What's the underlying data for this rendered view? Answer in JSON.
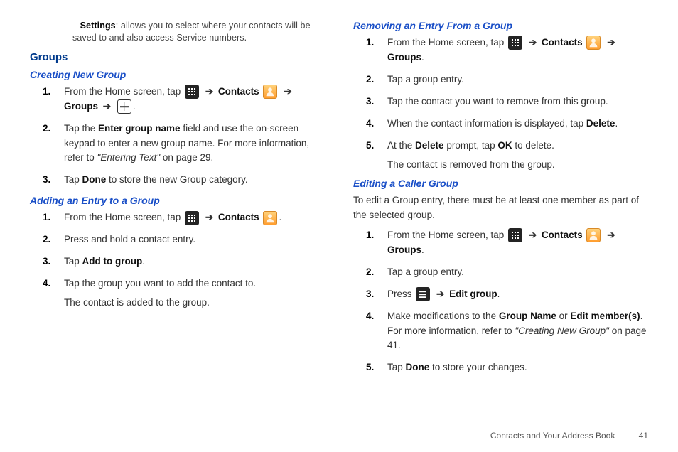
{
  "left": {
    "settings_lead": "Settings",
    "settings_rest": ": allows you to select where your contacts will be saved to and also access Service numbers.",
    "h2_groups": "Groups",
    "h3_creating": "Creating New Group",
    "creating": {
      "s1_a": "From the Home screen, tap ",
      "s1_b": " Contacts ",
      "s1_c": " Groups ",
      "s1_d": ".",
      "s2_a": "Tap the ",
      "s2_b": "Enter group name",
      "s2_c": " field and use the on-screen keypad to enter a new group name. For more information, refer to ",
      "s2_d": "\"Entering Text\"",
      "s2_e": "  on page 29.",
      "s3_a": "Tap ",
      "s3_b": "Done",
      "s3_c": " to store the new Group category."
    },
    "h3_adding": "Adding an Entry to a Group",
    "adding": {
      "s1_a": "From the Home screen, tap ",
      "s1_b": " Contacts ",
      "s1_c": ".",
      "s2": "Press and hold a contact entry.",
      "s3_a": "Tap ",
      "s3_b": "Add to group",
      "s3_c": ".",
      "s4": "Tap the group you want to add the contact to.",
      "s4_cont": "The contact is added to the group."
    }
  },
  "right": {
    "h3_removing": "Removing an Entry From a Group",
    "removing": {
      "s1_a": "From the Home screen, tap ",
      "s1_b": " Contacts ",
      "s1_c": " Groups",
      "s1_d": ".",
      "s2": "Tap a group entry.",
      "s3": "Tap the contact you want to remove from this group.",
      "s4_a": "When the contact information is displayed, tap ",
      "s4_b": "Delete",
      "s4_c": ".",
      "s5_a": "At the ",
      "s5_b": "Delete",
      "s5_c": " prompt, tap ",
      "s5_d": "OK",
      "s5_e": " to delete.",
      "s5_cont": "The contact is removed from the group."
    },
    "h3_editing": "Editing a Caller Group",
    "editing_intro": "To edit a Group entry, there must be at least one member as part of the selected group.",
    "editing": {
      "s1_a": "From the Home screen, tap ",
      "s1_b": " Contacts ",
      "s1_c": " Groups",
      "s1_d": ".",
      "s2": "Tap a group entry.",
      "s3_a": "Press ",
      "s3_b": " Edit group",
      "s3_c": ".",
      "s4_a": "Make modifications to the ",
      "s4_b": "Group Name",
      "s4_c": " or ",
      "s4_d": "Edit member(s)",
      "s4_e": ". For more information, refer to ",
      "s4_f": "\"Creating New Group\"",
      "s4_g": "  on page 41.",
      "s5_a": "Tap ",
      "s5_b": "Done",
      "s5_c": " to store your changes."
    }
  },
  "arrows": {
    "r": "➔"
  },
  "footer": {
    "title": "Contacts and Your Address Book",
    "page": "41"
  }
}
